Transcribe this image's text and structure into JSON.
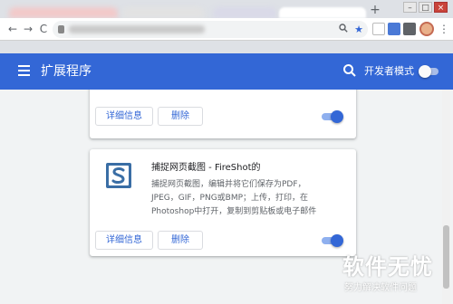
{
  "browser": {
    "new_tab_glyph": "+",
    "window_controls": [
      "–",
      "□",
      "×"
    ],
    "nav": {
      "back": "←",
      "forward": "→",
      "reload": "C",
      "menu": "⋮"
    },
    "omnibox_icons": [
      "search-icon",
      "star-icon"
    ]
  },
  "header": {
    "title": "扩展程序",
    "developer_mode_label": "开发者模式",
    "developer_mode_on": false,
    "background_color": "#3367d6"
  },
  "extensions": [
    {
      "name": "",
      "details_label": "详细信息",
      "remove_label": "删除",
      "enabled": true
    },
    {
      "name": "捕捉网页截图 - FireShot的",
      "description_lines": [
        "捕捉网页截图，编辑并将它们保存为PDF，",
        "JPEG，GIF，PNG或BMP；上传，打印，在",
        "Photoshop中打开，复制到剪贴板或电子邮件"
      ],
      "details_label": "详细信息",
      "remove_label": "删除",
      "enabled": true,
      "icon": "fireshot-s-logo"
    }
  ],
  "watermark": {
    "main": "软件无忧",
    "sub": "努力解决软件问题"
  },
  "colors": {
    "accent": "#3367d6",
    "page_background": "#f1f3f4"
  }
}
